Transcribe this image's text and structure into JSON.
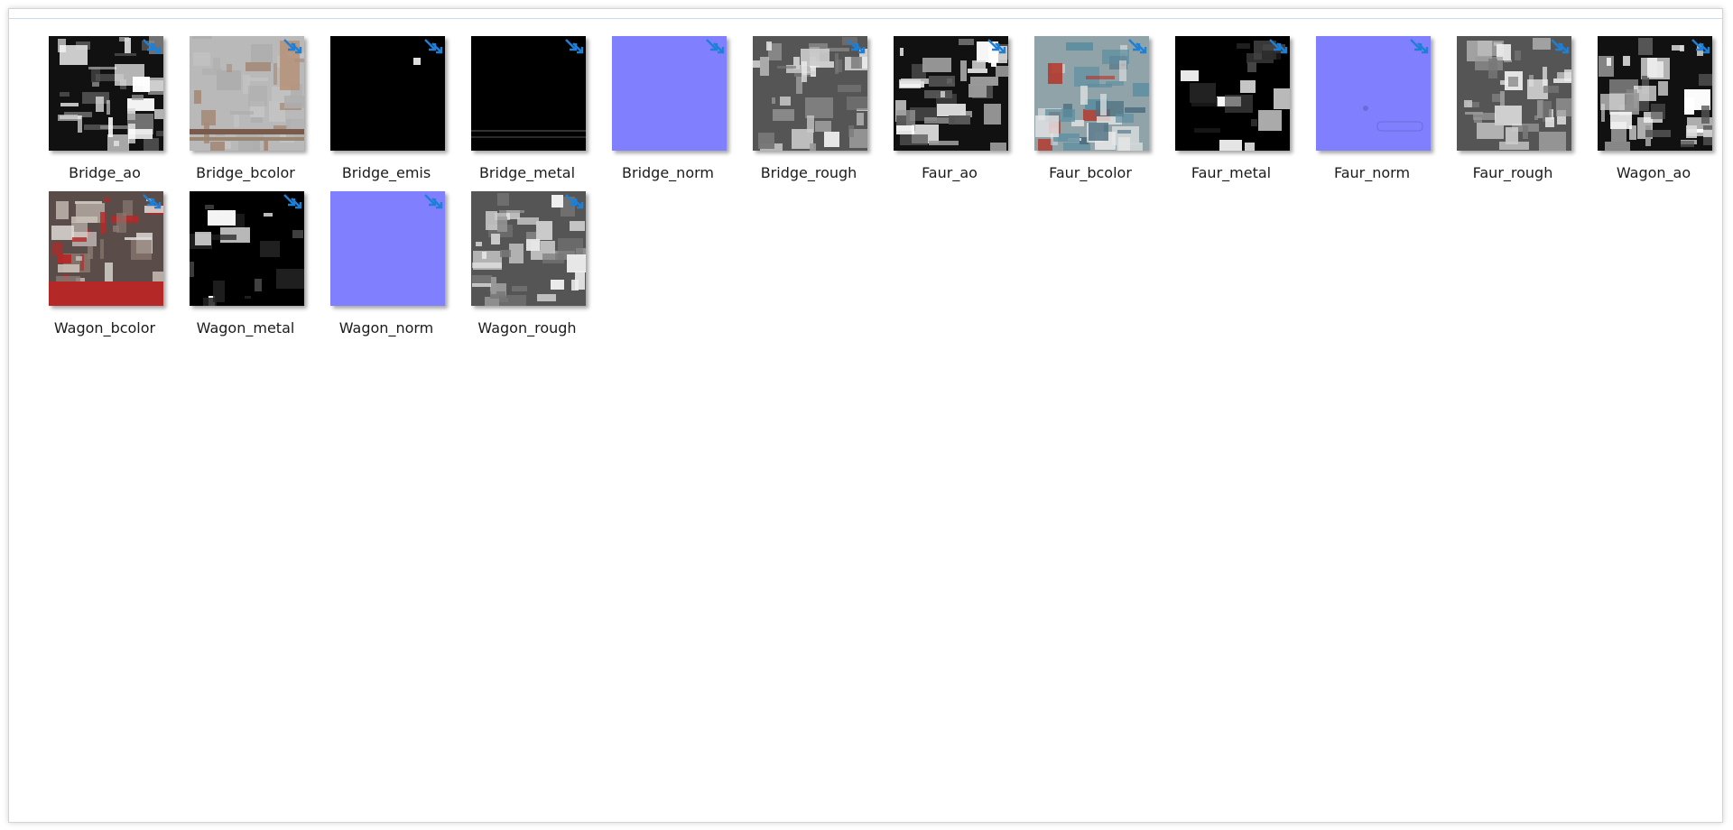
{
  "explorer": {
    "files": [
      {
        "name": "Bridge_ao",
        "kind": "ao"
      },
      {
        "name": "Bridge_bcolor",
        "kind": "bcolor_bridge"
      },
      {
        "name": "Bridge_emis",
        "kind": "emis"
      },
      {
        "name": "Bridge_metal",
        "kind": "metal_bridge"
      },
      {
        "name": "Bridge_norm",
        "kind": "norm"
      },
      {
        "name": "Bridge_rough",
        "kind": "rough"
      },
      {
        "name": "Faur_ao",
        "kind": "ao"
      },
      {
        "name": "Faur_bcolor",
        "kind": "bcolor_faur"
      },
      {
        "name": "Faur_metal",
        "kind": "metal"
      },
      {
        "name": "Faur_norm",
        "kind": "norm"
      },
      {
        "name": "Faur_rough",
        "kind": "rough"
      },
      {
        "name": "Wagon_ao",
        "kind": "ao"
      },
      {
        "name": "Wagon_bcolor",
        "kind": "bcolor_wagon"
      },
      {
        "name": "Wagon_metal",
        "kind": "metal"
      },
      {
        "name": "Wagon_norm",
        "kind": "norm"
      },
      {
        "name": "Wagon_rough",
        "kind": "rough"
      }
    ]
  },
  "icons": {
    "shortcut_badge": "compress-arrows-icon"
  },
  "colors": {
    "accent": "#1e7fd6",
    "normal_map": "#8080ff",
    "label_text": "#1b1b1b"
  }
}
